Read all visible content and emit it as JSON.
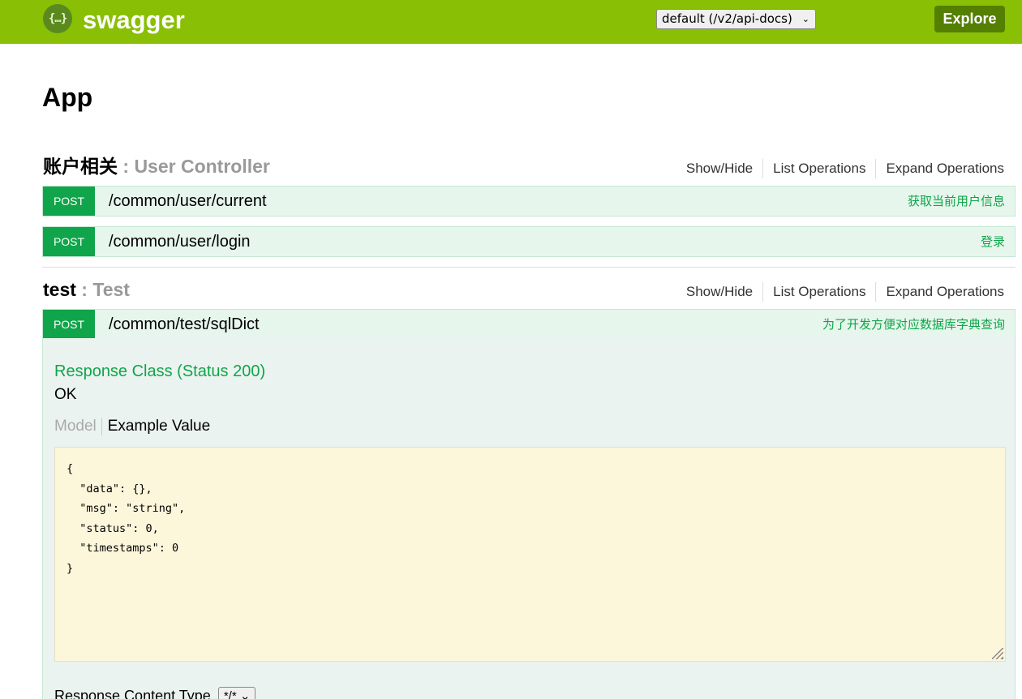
{
  "header": {
    "logo_glyph": "{…}",
    "logo_text": "swagger",
    "spec_select_value": "default (/v2/api-docs)",
    "explore_label": "Explore",
    "colors": {
      "bar": "#89bf04",
      "explore": "#547f00"
    }
  },
  "app_title": "App",
  "resources": [
    {
      "name": "账户相关",
      "desc": ": User Controller",
      "ops_links": [
        "Show/Hide",
        "List Operations",
        "Expand Operations"
      ],
      "operations": [
        {
          "method": "POST",
          "path": "/common/user/current",
          "summary": "获取当前用户信息"
        },
        {
          "method": "POST",
          "path": "/common/user/login",
          "summary": "登录"
        }
      ]
    },
    {
      "name": "test",
      "desc": ": Test",
      "ops_links": [
        "Show/Hide",
        "List Operations",
        "Expand Operations"
      ],
      "operations": [
        {
          "method": "POST",
          "path": "/common/test/sqlDict",
          "summary": "为了开发方便对应数据库字典查询"
        }
      ]
    }
  ],
  "expanded_op": {
    "response_class": "Response Class (Status 200)",
    "response_text": "OK",
    "tab_model": "Model",
    "tab_example": "Example Value",
    "example_lines": [
      "{",
      "  \"data\": {},",
      "  \"msg\": \"string\",",
      "  \"status\": 0,",
      "  \"timestamps\": 0",
      "}"
    ],
    "content_type_label": "Response Content Type",
    "content_type_value": "*/*"
  },
  "colors": {
    "post": "#10a54a",
    "post_bg": "#e7f6ec",
    "code_bg": "#fcf6db"
  }
}
